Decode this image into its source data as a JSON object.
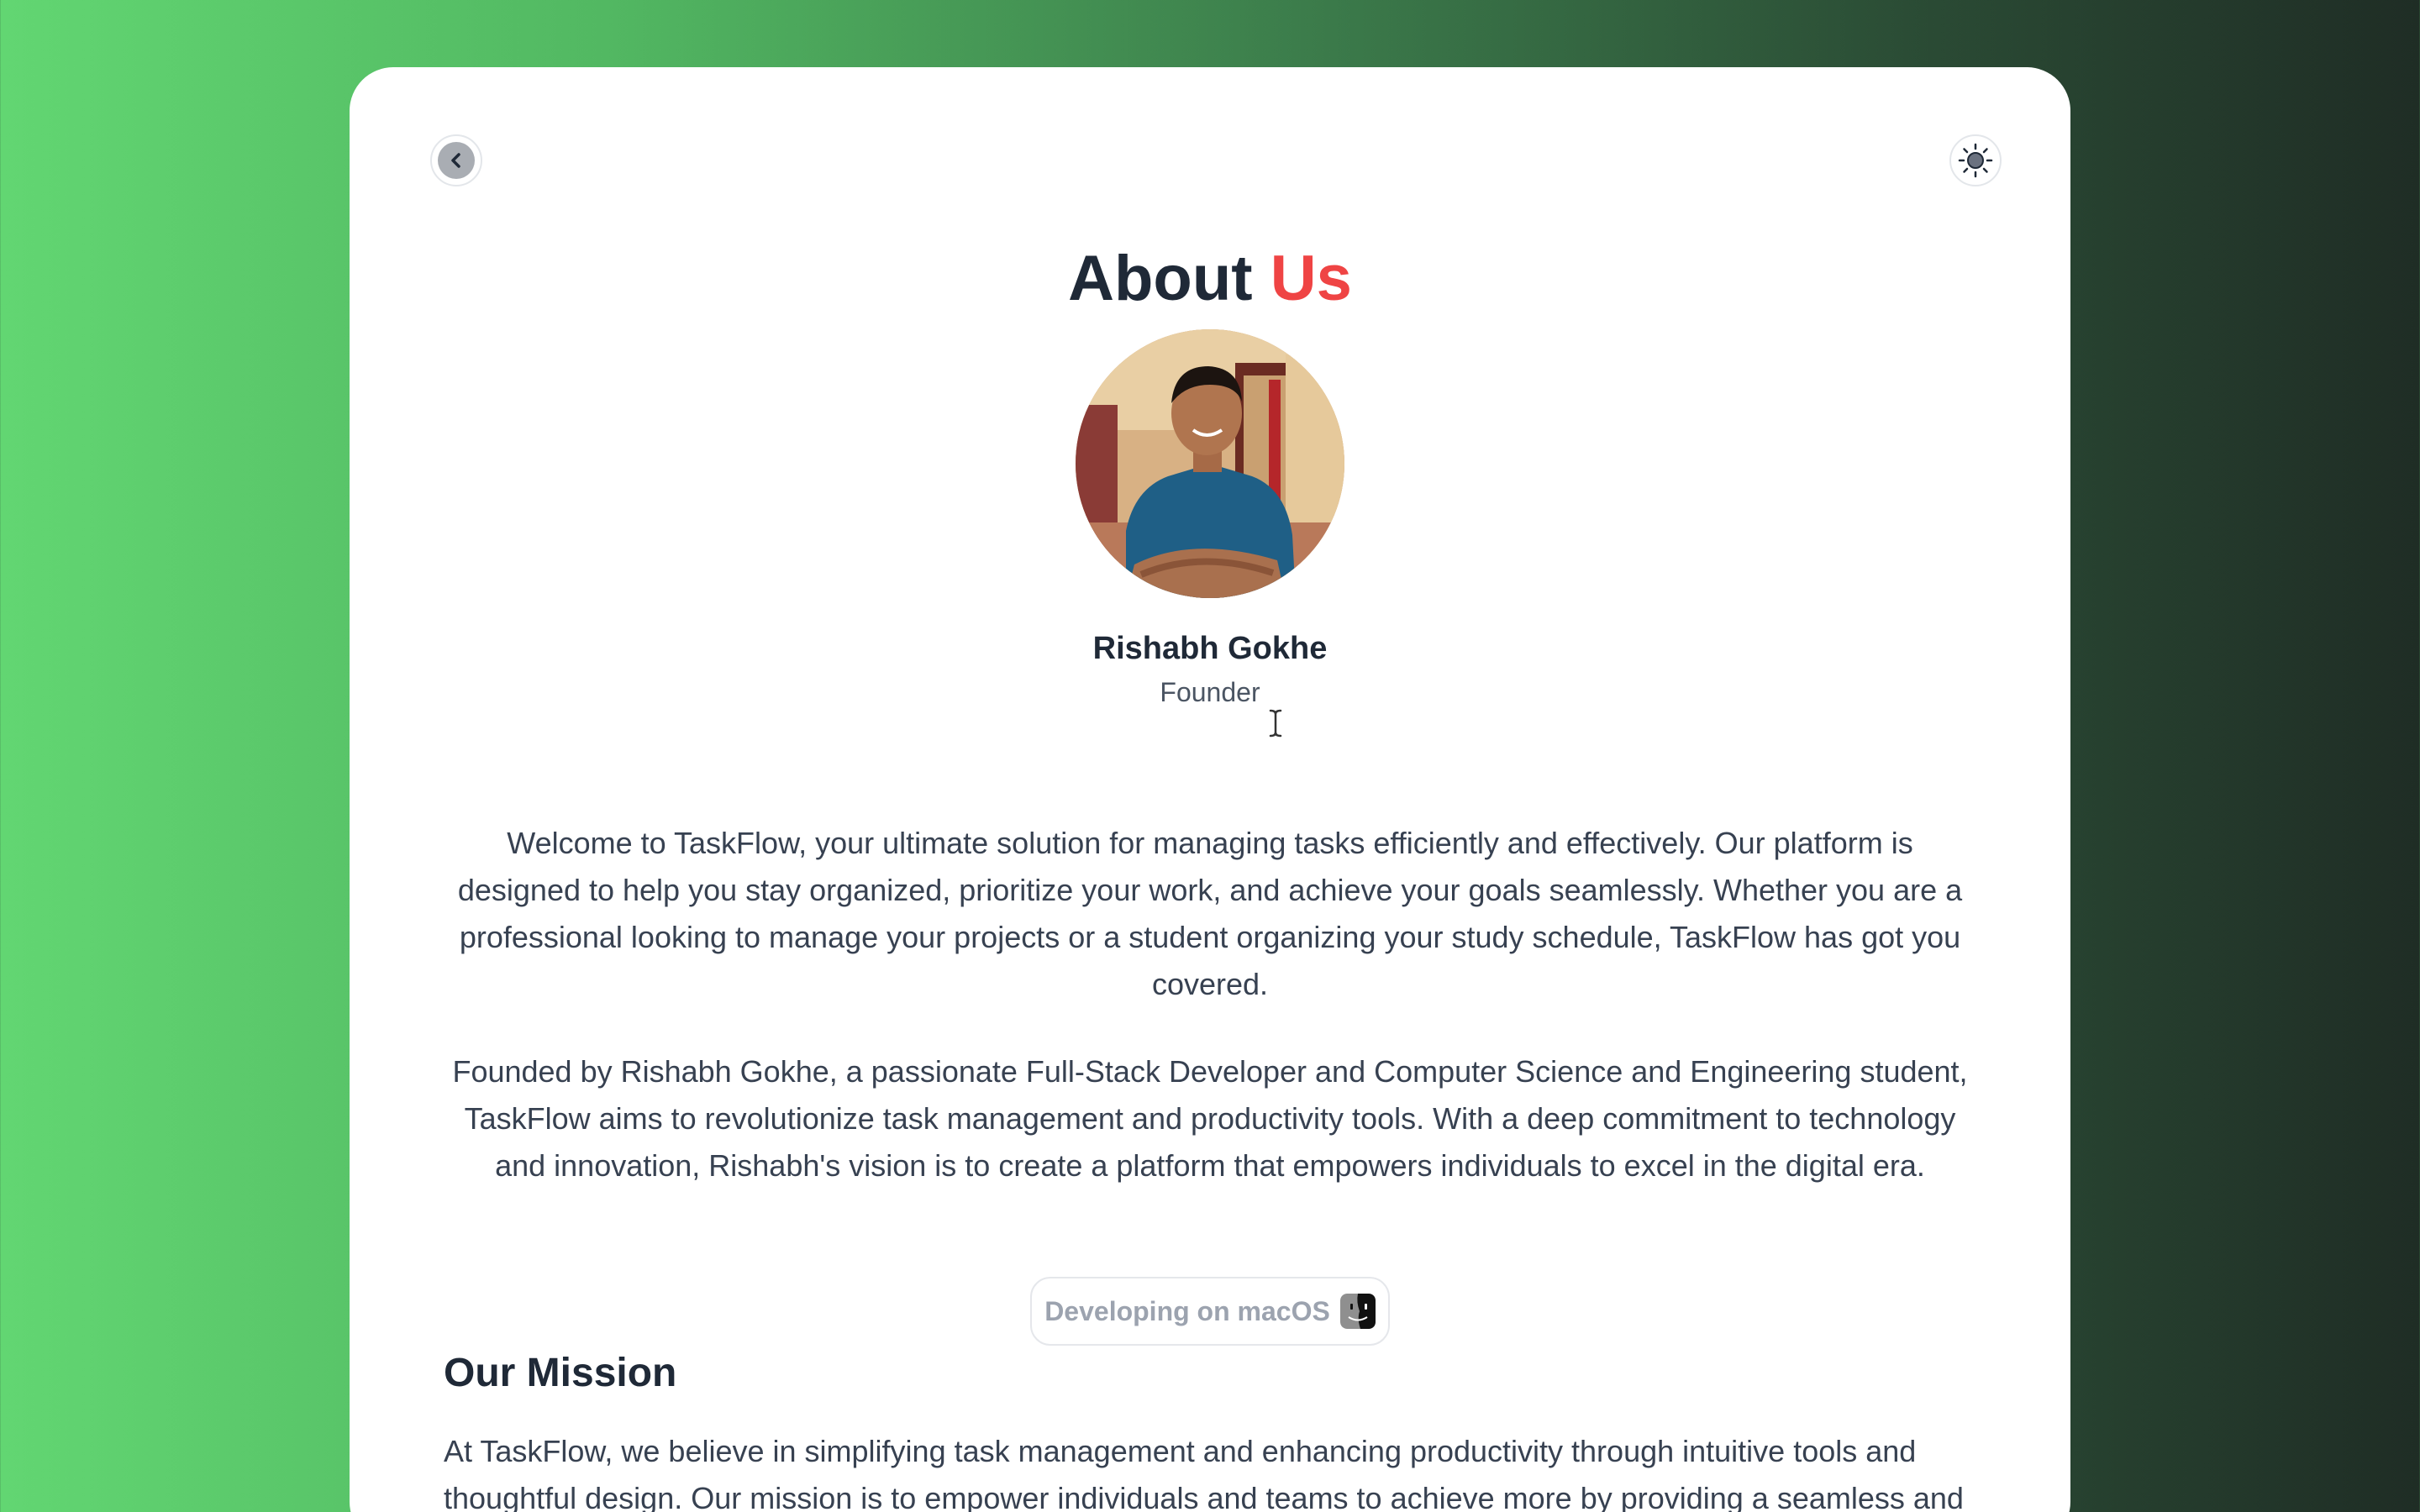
{
  "page": {
    "title_main": "About",
    "title_accent": "Us"
  },
  "controls": {
    "back_icon": "chevron-left-icon",
    "theme_icon": "sun-icon"
  },
  "profile": {
    "name": "Rishabh Gokhe",
    "role": "Founder"
  },
  "content": {
    "intro": "Welcome to TaskFlow, your ultimate solution for managing tasks efficiently and effectively. Our platform is designed to help you stay organized, prioritize your work, and achieve your goals seamlessly. Whether you are a professional looking to manage your projects or a student organizing your study schedule, TaskFlow has got you covered.",
    "founder": "Founded by Rishabh Gokhe, a passionate Full-Stack Developer and Computer Science and Engineering student, TaskFlow aims to revolutionize task management and productivity tools. With a deep commitment to technology and innovation, Rishabh's vision is to create a platform that empowers individuals to excel in the digital era."
  },
  "badge": {
    "label": "Developing on macOS",
    "icon": "finder-icon"
  },
  "mission": {
    "heading": "Our Mission",
    "text": "At TaskFlow, we believe in simplifying task management and enhancing productivity through intuitive tools and thoughtful design. Our mission is to empower individuals and teams to achieve more by providing a seamless and enjoyable task management experience."
  },
  "colors": {
    "accent": "#ef4444",
    "heading": "#1f2937",
    "body_text": "#374151",
    "gradient_start": "#62d672",
    "gradient_end": "#1f2d25"
  }
}
